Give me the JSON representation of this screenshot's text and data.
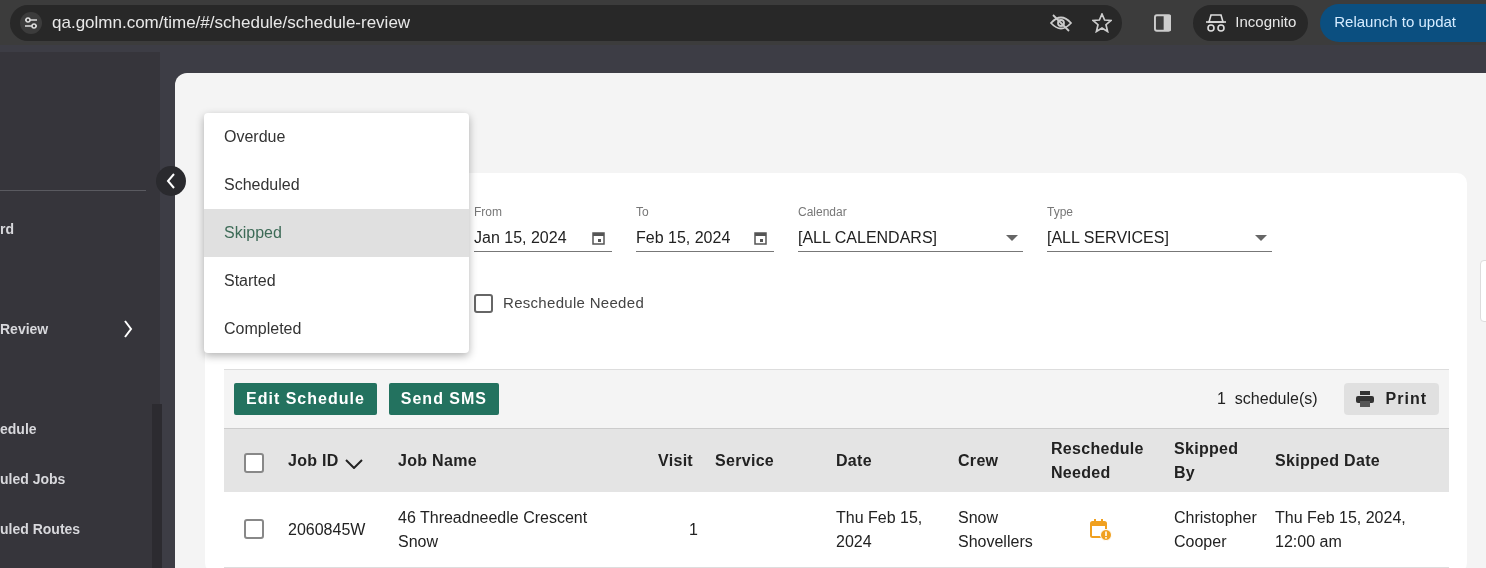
{
  "browser": {
    "url": "qa.golmn.com/time/#/schedule/schedule-review",
    "profile": "Incognito",
    "relaunch": "Relaunch to updat"
  },
  "sidebar": {
    "items": [
      {
        "label": "rd",
        "expandable": false
      },
      {
        "label": "Review",
        "expandable": true
      },
      {
        "label": "edule",
        "expandable": false
      },
      {
        "label": "uled Jobs",
        "expandable": false
      },
      {
        "label": "uled Routes",
        "expandable": false
      }
    ]
  },
  "status_menu": {
    "options": [
      {
        "label": "Overdue",
        "selected": false
      },
      {
        "label": "Scheduled",
        "selected": false
      },
      {
        "label": "Skipped",
        "selected": true
      },
      {
        "label": "Started",
        "selected": false
      },
      {
        "label": "Completed",
        "selected": false
      }
    ]
  },
  "filters": [
    {
      "kind": "date",
      "label": "From",
      "value": "Jan 15, 2024"
    },
    {
      "kind": "date",
      "label": "To",
      "value": "Feb 15, 2024"
    },
    {
      "kind": "select",
      "label": "Calendar",
      "value": "[ALL CALENDARS]"
    },
    {
      "kind": "select",
      "label": "Type",
      "value": "[ALL SERVICES]"
    }
  ],
  "reschedule_needed": {
    "label": "Reschedule Needed",
    "checked": false
  },
  "toolbar": {
    "buttons": [
      "Edit Schedule",
      "Send SMS"
    ],
    "count": "1",
    "count_label": "schedule(s)",
    "print": "Print"
  },
  "table": {
    "select_all": false,
    "columns": [
      "Job ID",
      "Job Name",
      "Visit",
      "Service",
      "Date",
      "Crew",
      "Reschedule Needed",
      "Skipped By",
      "Skipped Date"
    ],
    "rows": [
      {
        "selected": false,
        "reschedule_needed": true,
        "cells": [
          "2060845W",
          "46 Threadneedle Crescent Snow",
          "1",
          "",
          "Thu Feb 15, 2024",
          "Snow Shovellers",
          "",
          "Christopher Cooper",
          "Thu Feb 15, 2024, 12:00 am"
        ]
      }
    ]
  }
}
